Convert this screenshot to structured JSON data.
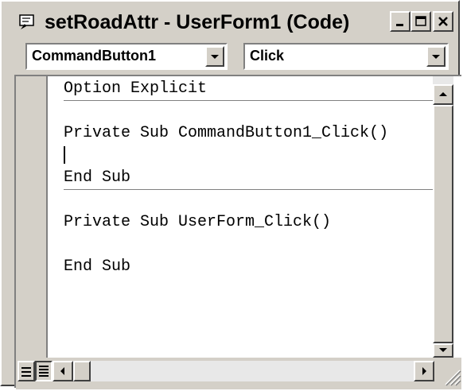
{
  "window": {
    "title": "setRoadAttr - UserForm1 (Code)",
    "icon": "code-window-icon",
    "buttons": [
      "minimize-icon",
      "restore-icon",
      "close-icon"
    ]
  },
  "object_combo": {
    "value": "CommandButton1"
  },
  "procedure_combo": {
    "value": "Click"
  },
  "code": {
    "lines": [
      "Option Explicit",
      "",
      "Private Sub CommandButton1_Click()",
      "",
      "End Sub",
      "",
      "Private Sub UserForm_Click()",
      "",
      "End Sub"
    ]
  },
  "colors": {
    "face": "#d4d0c8",
    "shadow": "#808080",
    "dark_shadow": "#404040",
    "highlight": "#ffffff",
    "text": "#000000"
  }
}
